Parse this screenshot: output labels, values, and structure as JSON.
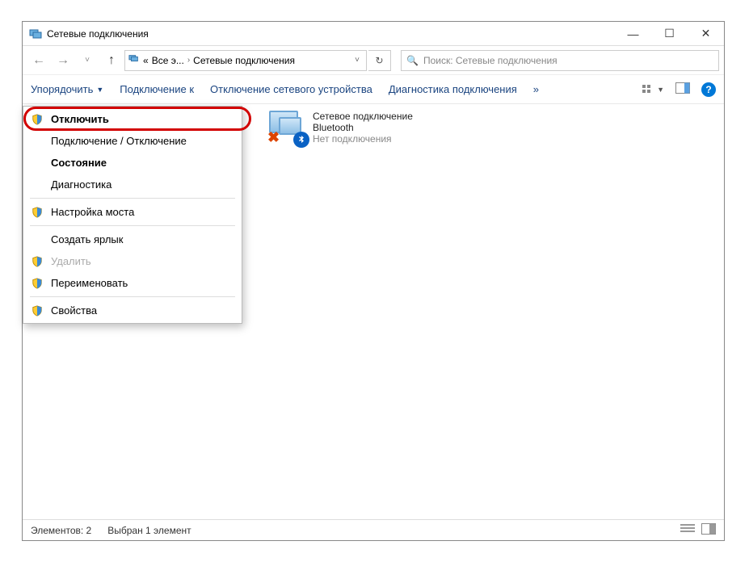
{
  "window": {
    "title": "Сетевые подключения"
  },
  "addrbar": {
    "prefix": "«",
    "crumb1": "Все э...",
    "crumb2": "Сетевые подключения"
  },
  "search": {
    "placeholder": "Поиск: Сетевые подключения"
  },
  "toolbar": {
    "organize": "Упорядочить",
    "connect_to": "Подключение к",
    "disable_device": "Отключение сетевого устройства",
    "diagnose": "Диагностика подключения",
    "more": "»"
  },
  "net_item": {
    "line1": "Сетевое подключение",
    "line2": "Bluetooth",
    "line3": "Нет подключения"
  },
  "context_menu": {
    "items": [
      {
        "label": "Отключить",
        "shield": true,
        "bold": true,
        "highlight": true
      },
      {
        "label": "Подключение / Отключение"
      },
      {
        "label": "Состояние",
        "bold": true
      },
      {
        "label": "Диагностика"
      },
      {
        "sep": true
      },
      {
        "label": "Настройка моста",
        "shield": true
      },
      {
        "sep": true
      },
      {
        "label": "Создать ярлык"
      },
      {
        "label": "Удалить",
        "shield": true,
        "disabled": true
      },
      {
        "label": "Переименовать",
        "shield": true
      },
      {
        "sep": true
      },
      {
        "label": "Свойства",
        "shield": true
      }
    ]
  },
  "statusbar": {
    "count_label": "Элементов: 2",
    "selected_label": "Выбран 1 элемент"
  }
}
